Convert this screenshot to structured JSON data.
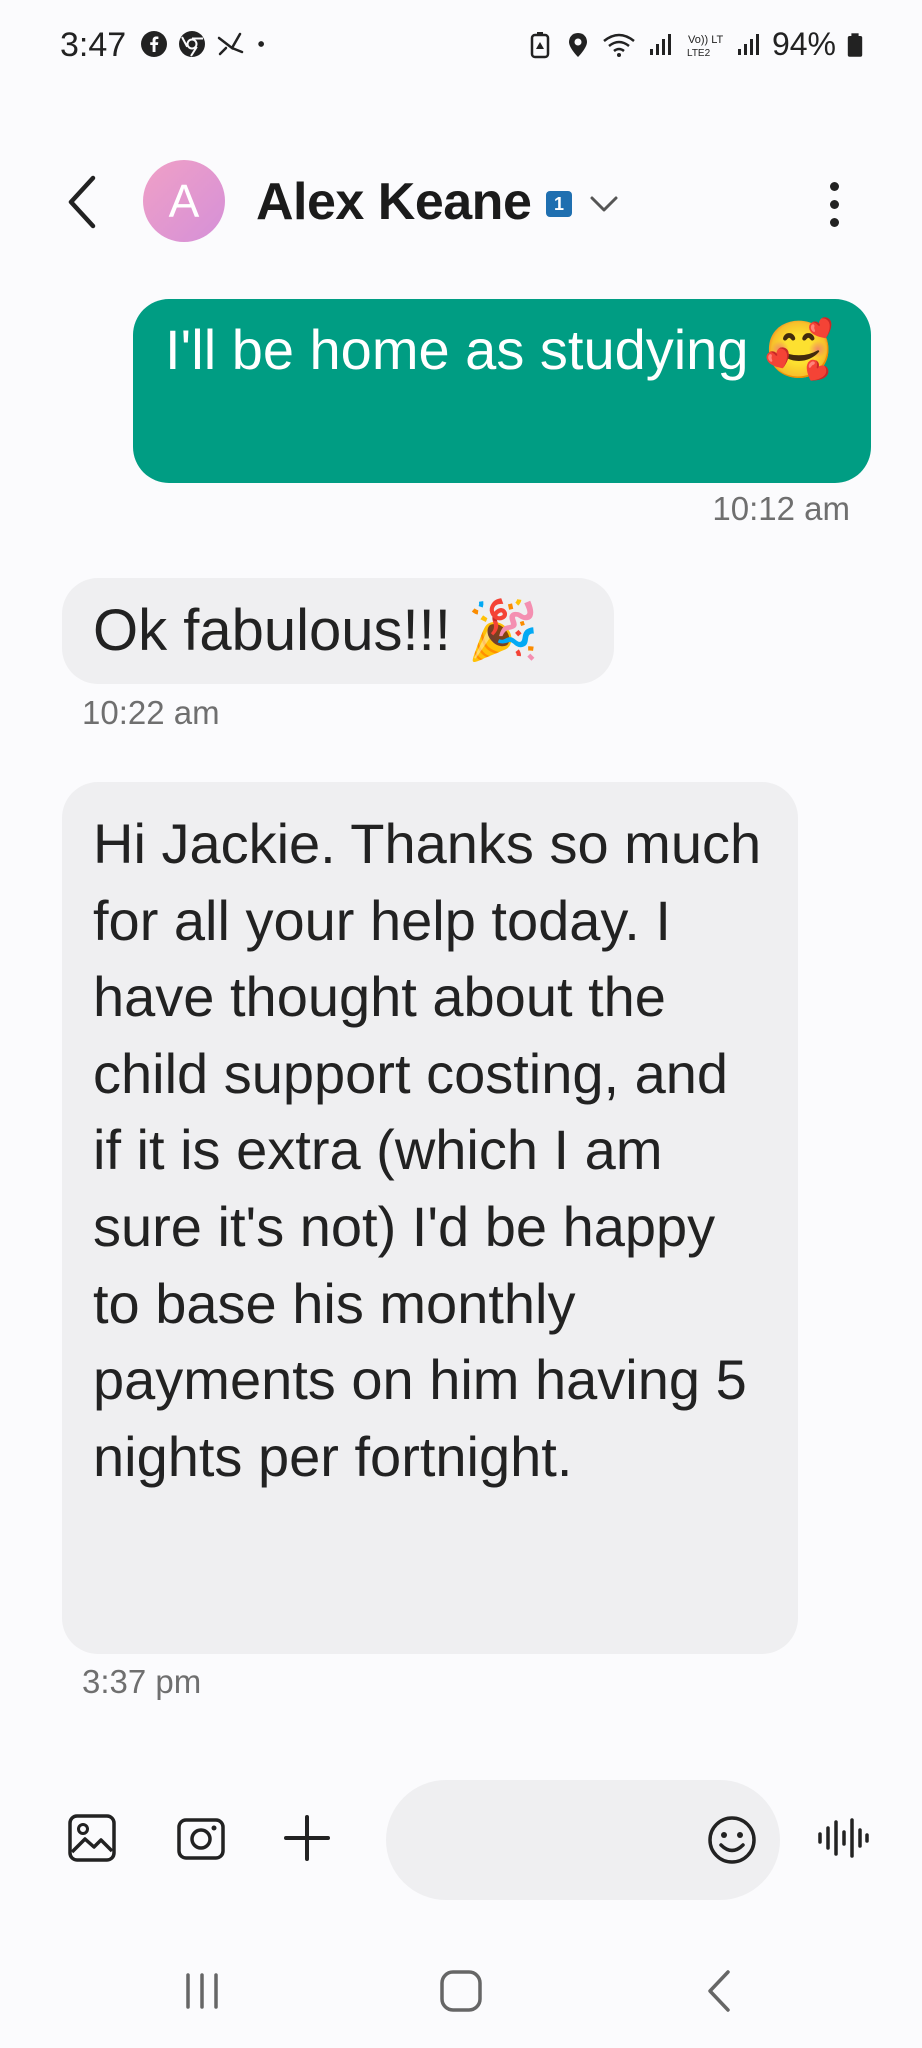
{
  "status_bar": {
    "time": "3:47",
    "battery_percent": "94%",
    "left_icons": [
      "facebook-icon",
      "chrome-icon",
      "bird-app-icon",
      "dot-icon"
    ],
    "right_icons": [
      "battery-saver-icon",
      "location-icon",
      "wifi-icon",
      "signal-icon",
      "volte-icon",
      "signal-icon",
      "battery-icon"
    ],
    "volte_label": "Vo)) LTE2"
  },
  "header": {
    "avatar_initial": "A",
    "contact_name": "Alex Keane",
    "sim_badge": "1"
  },
  "messages": [
    {
      "direction": "outgoing",
      "text": "I'll be home as studying 🥰",
      "time": "10:12 am"
    },
    {
      "direction": "incoming",
      "text": "Ok fabulous!!! 🎉",
      "time": "10:22 am"
    },
    {
      "direction": "incoming",
      "text": "Hi Jackie. Thanks so much for all your help today. I have thought about the child support costing, and if it is extra (which I am sure it's not) I'd be happy to base his monthly payments on him having 5 nights per fortnight.",
      "time": "3:37 pm"
    }
  ],
  "composer": {
    "input_value": "",
    "input_placeholder": ""
  },
  "colors": {
    "outgoing_bubble": "#009d83",
    "incoming_bubble": "#efeff1",
    "background": "#fbfbfd",
    "sim_badge": "#1f6fb0"
  }
}
